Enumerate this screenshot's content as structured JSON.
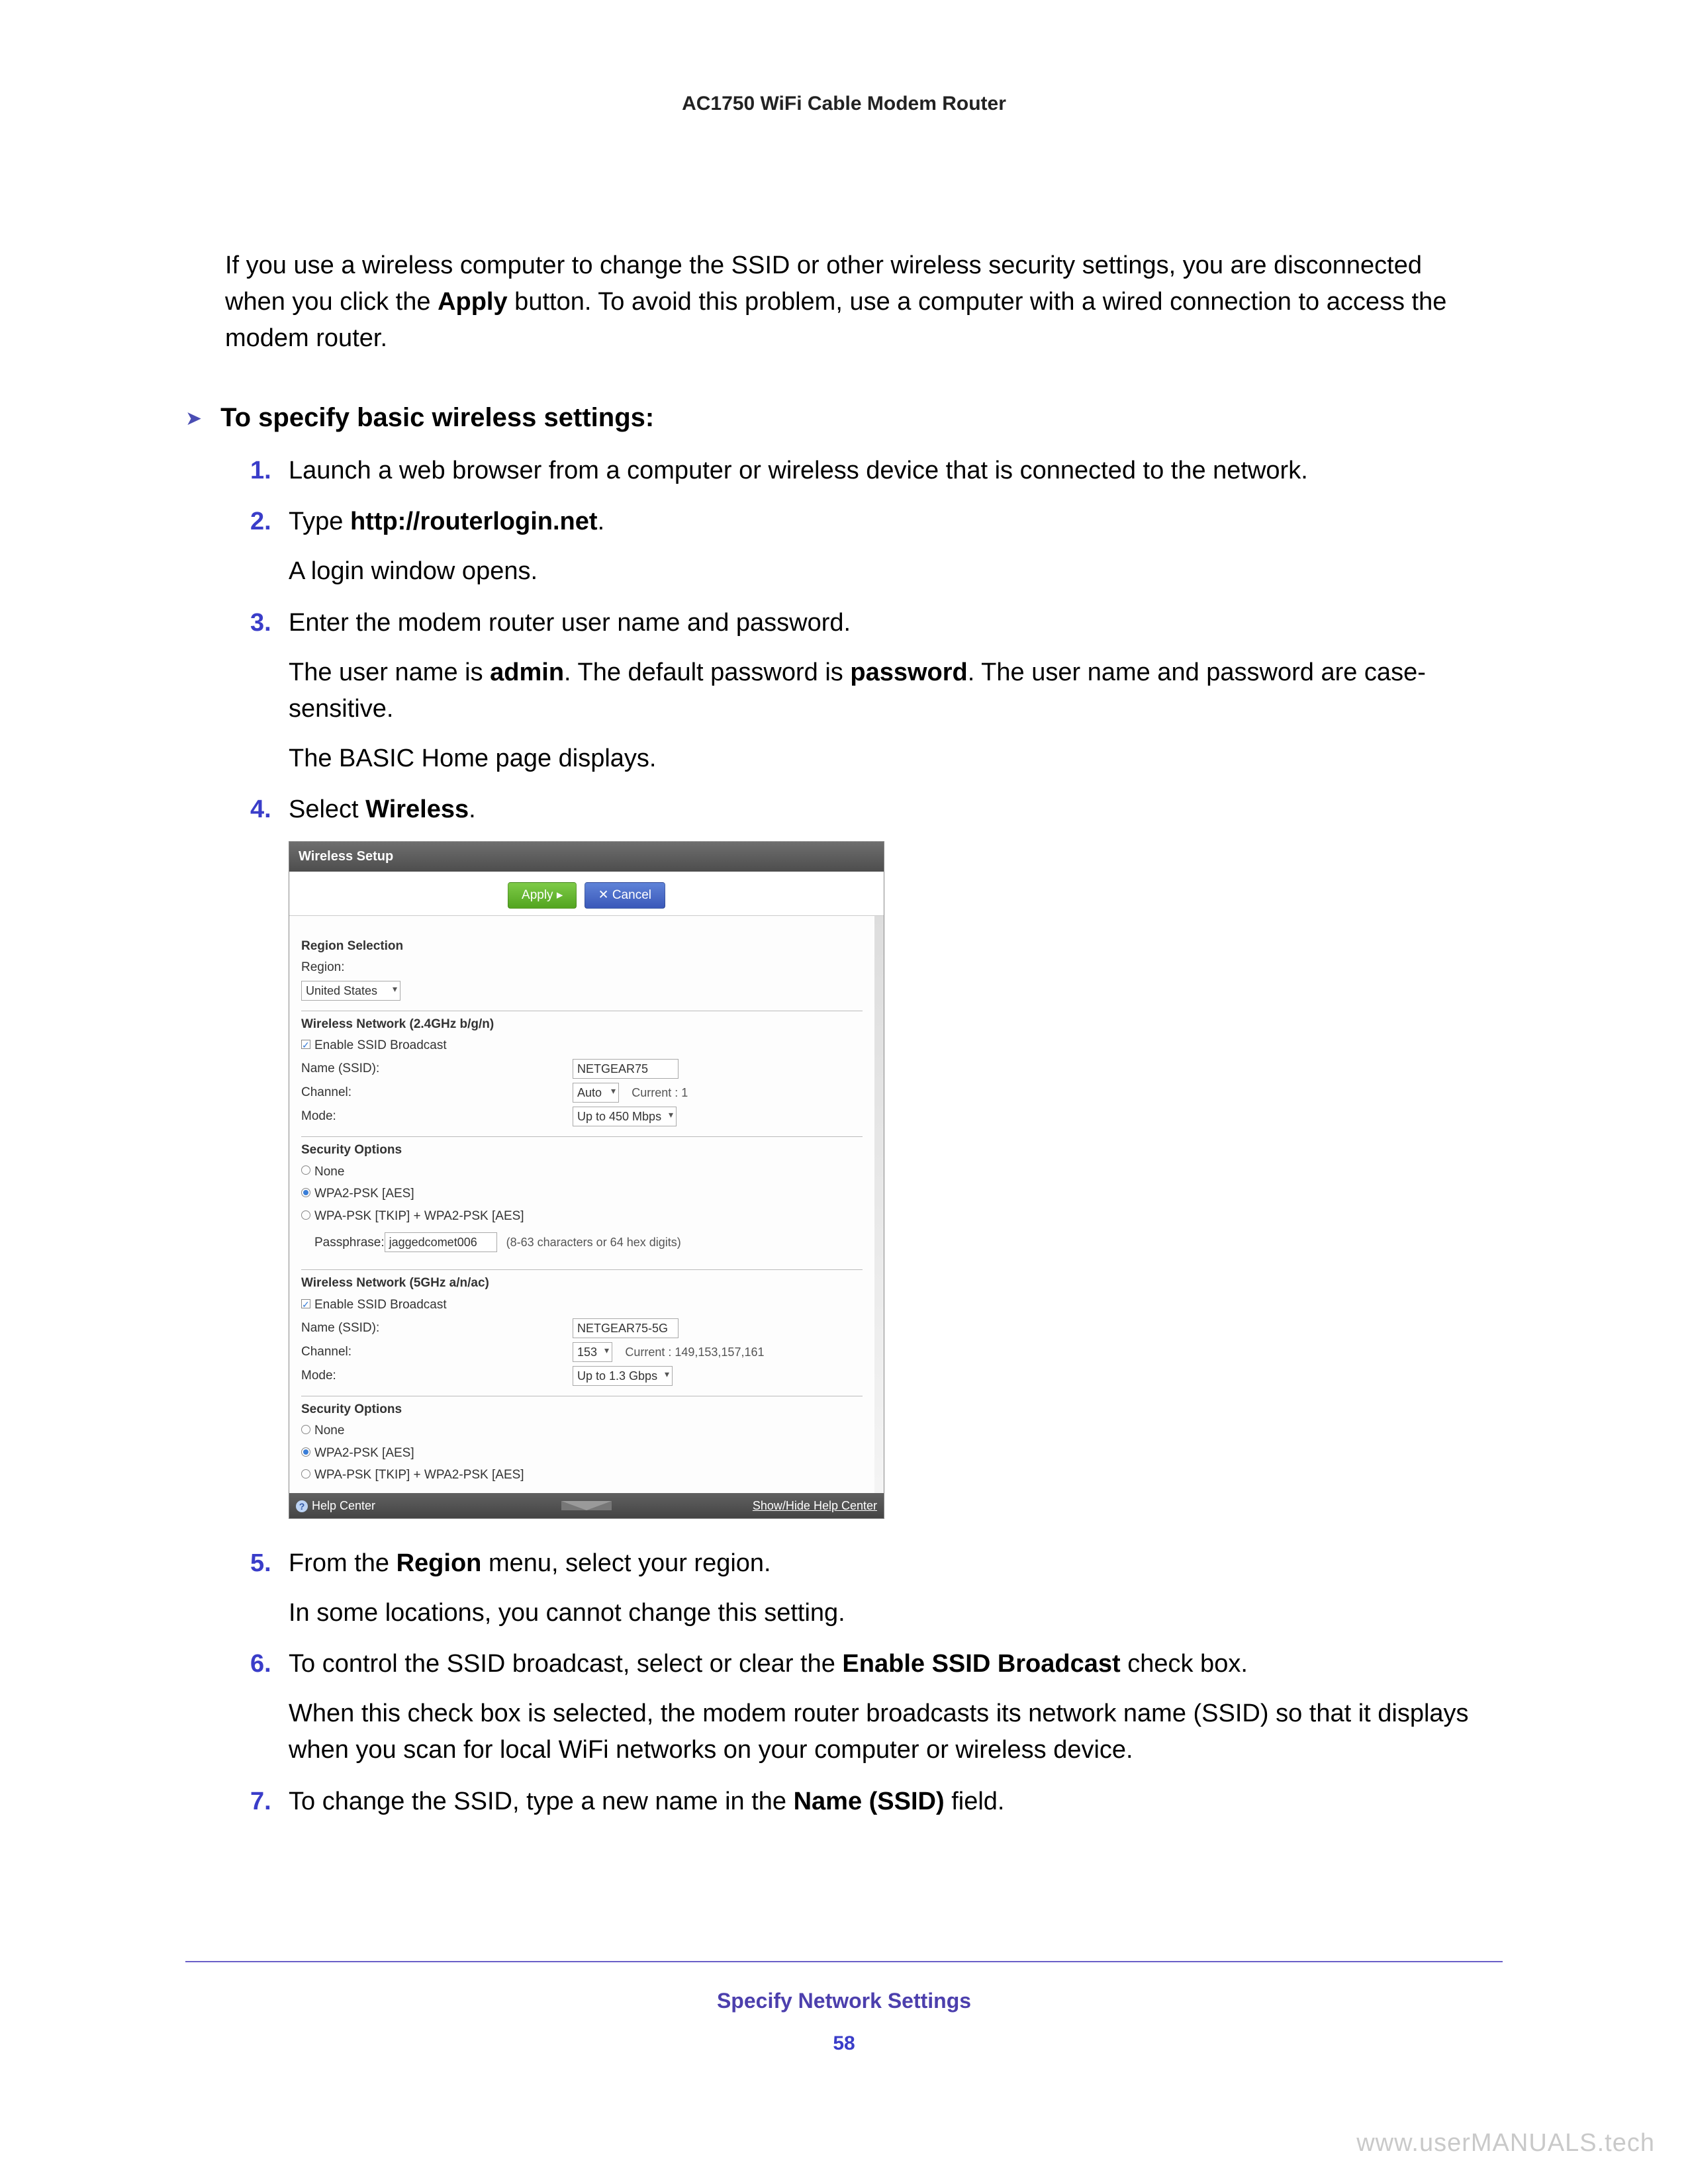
{
  "header": {
    "title": "AC1750 WiFi Cable Modem Router"
  },
  "intro": {
    "p1_a": "If you use a wireless computer to change the SSID or other wireless security settings, you are disconnected when you click the ",
    "p1_bold": "Apply",
    "p1_b": " button. To avoid this problem, use a computer with a wired connection to access the modem router."
  },
  "section": {
    "chevron": "➤",
    "head": "To specify basic wireless settings:"
  },
  "steps": {
    "s1": "Launch a web browser from a computer or wireless device that is connected to the network.",
    "s2_a": "Type ",
    "s2_bold": "http://routerlogin.net",
    "s2_b": ".",
    "s2_sub": "A login window opens.",
    "s3": "Enter the modem router user name and password.",
    "s3_sub1_a": "The user name is ",
    "s3_sub1_bold1": "admin",
    "s3_sub1_b": ". The default password is ",
    "s3_sub1_bold2": "password",
    "s3_sub1_c": ". The user name and password are case-sensitive.",
    "s3_sub2": "The BASIC Home page displays.",
    "s4_a": "Select ",
    "s4_bold": "Wireless",
    "s4_b": ".",
    "s5_a": "From the ",
    "s5_bold": "Region",
    "s5_b": " menu, select your region.",
    "s5_sub": "In some locations, you cannot change this setting.",
    "s6_a": "To control the SSID broadcast, select or clear the ",
    "s6_bold": "Enable SSID Broadcast",
    "s6_b": " check box.",
    "s6_sub": "When this check box is selected, the modem router broadcasts its network name (SSID) so that it displays when you scan for local WiFi networks on your computer or wireless device.",
    "s7_a": "To change the SSID, type a new name in the ",
    "s7_bold": "Name (SSID)",
    "s7_b": " field."
  },
  "router": {
    "title": "Wireless Setup",
    "apply_label": "Apply  ▸",
    "cancel_label": "✕ Cancel",
    "region_section": "Region Selection",
    "region_label": "Region:",
    "region_value": "United States",
    "net24_title": "Wireless Network (2.4GHz b/g/n)",
    "enable_ssid": "Enable SSID Broadcast",
    "name_label": "Name (SSID):",
    "name24_value": "NETGEAR75",
    "channel_label": "Channel:",
    "channel24_value": "Auto",
    "channel24_current": "Current : 1",
    "mode_label": "Mode:",
    "mode24_value": "Up to 450 Mbps",
    "security_title": "Security Options",
    "sec_none": "None",
    "sec_wpa2": "WPA2-PSK [AES]",
    "sec_mixed": "WPA-PSK [TKIP] + WPA2-PSK [AES]",
    "pass_label": "Passphrase:",
    "pass_value": "jaggedcomet006",
    "pass_hint": "(8-63 characters or 64 hex digits)",
    "net5_title": "Wireless Network (5GHz a/n/ac)",
    "name5_value": "NETGEAR75-5G",
    "channel5_value": "153",
    "channel5_current": "Current : 149,153,157,161",
    "mode5_value": "Up to 1.3 Gbps",
    "help_center": "Help Center",
    "show_hide": "Show/Hide Help Center"
  },
  "footer": {
    "section_title": "Specify Network Settings",
    "page_number": "58",
    "watermark": "www.userMANUALS.tech"
  }
}
